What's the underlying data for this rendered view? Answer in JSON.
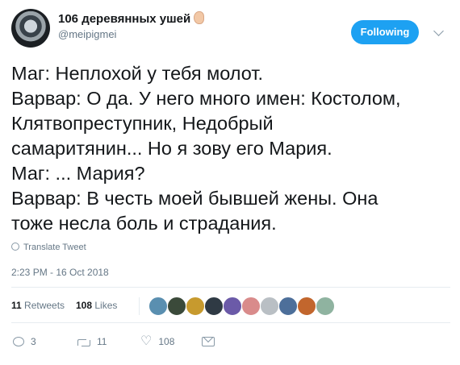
{
  "author": {
    "display_name": "106 деревянных ушей",
    "handle": "@meipigmei",
    "avatar_icon": "avatar-image",
    "name_emoji_icon": "ear-icon"
  },
  "header": {
    "follow_label": "Following",
    "caret_icon": "chevron-down-icon"
  },
  "tweet": {
    "lines": [
      "Маг: Неплохой у тебя молот.",
      "Варвар: О да. У него много имен: Костолом,",
      "Клятвопреступник, Недобрый",
      "самаритянин... Но я зову его Мария.",
      "Маг: ... Мария?",
      "Варвар: В честь моей бывшей жены. Она",
      "тоже несла боль и страдания."
    ],
    "translate_label": "Translate Tweet",
    "timestamp": "2:23 PM - 16 Oct 2018"
  },
  "stats": {
    "retweets_count": "11",
    "retweets_label": "Retweets",
    "likes_count": "108",
    "likes_label": "Likes",
    "likers": [
      {
        "color": "#5a8fb0"
      },
      {
        "color": "#3b4a3a"
      },
      {
        "color": "#c79a2e"
      },
      {
        "color": "#2f3a44"
      },
      {
        "color": "#6b5aa8"
      },
      {
        "color": "#d98b8b"
      },
      {
        "color": "#b9bfc4"
      },
      {
        "color": "#4d6f9a"
      },
      {
        "color": "#c2662d"
      },
      {
        "color": "#8fb3a0"
      }
    ]
  },
  "actions": {
    "reply_count": "3",
    "retweet_count": "11",
    "like_count": "108"
  },
  "colors": {
    "accent": "#1da1f2",
    "text": "#14171a",
    "secondary": "#657786",
    "divider": "#e6ecf0"
  }
}
